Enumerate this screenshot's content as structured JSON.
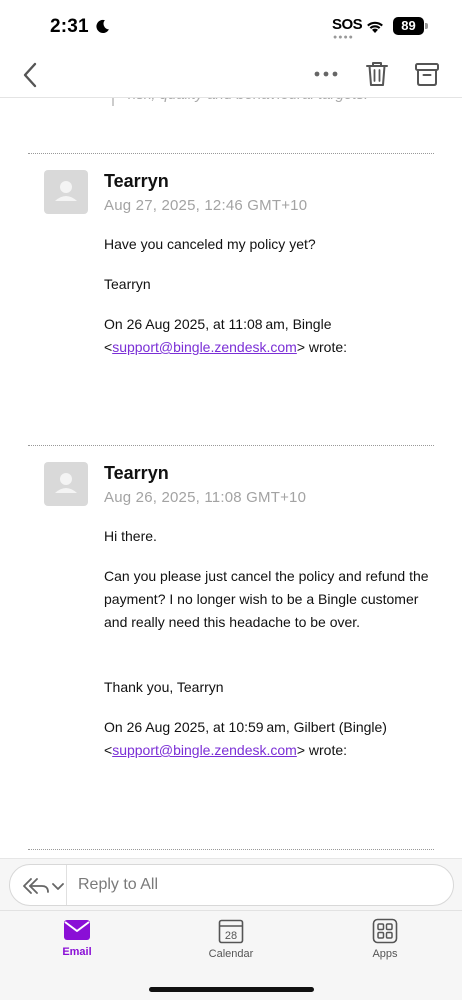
{
  "status_bar": {
    "time": "2:31",
    "sos": "SOS",
    "battery": "89"
  },
  "nav": {
    "back_icon": "chevron-left-icon",
    "more_icon": "ellipsis-icon",
    "trash_icon": "trash-icon",
    "archive_icon": "archive-icon"
  },
  "previous_quote": "risk, quality and behavioural targets.",
  "messages": [
    {
      "sender": "Tearryn",
      "datetime": "Aug 27, 2025, 12:46 GMT+10",
      "paragraphs": [
        "Have you canceled my policy yet?",
        "Tearryn"
      ],
      "quote_header_line1": "On 26 Aug 2025, at 11:08 am, Bingle",
      "quote_lt": "<",
      "quote_email": "support@bingle.zendesk.com",
      "quote_suffix": "> wrote:"
    },
    {
      "sender": "Tearryn",
      "datetime": "Aug 26, 2025, 11:08 GMT+10",
      "paragraphs": [
        "Hi there.",
        "Can you please just cancel the policy and refund the payment? I no longer wish to be a Bingle customer and really need this headache to be over.",
        "Thank you, Tearryn"
      ],
      "quote_header_line1": "On 26 Aug 2025, at 10:59 am, Gilbert (Bingle)",
      "quote_lt": "<",
      "quote_email": "support@bingle.zendesk.com",
      "quote_suffix": "> wrote:"
    }
  ],
  "reply": {
    "placeholder": "Reply to All",
    "icon": "reply-all-icon"
  },
  "tabs": [
    {
      "label": "Email",
      "icon": "envelope-icon",
      "active": true
    },
    {
      "label": "Calendar",
      "icon": "calendar-icon",
      "day": "28",
      "active": false
    },
    {
      "label": "Apps",
      "icon": "apps-grid-icon",
      "active": false
    }
  ],
  "colors": {
    "accent": "#8a0fd6",
    "link": "#7b2fd6",
    "meta_gray": "#a3a3a3"
  }
}
